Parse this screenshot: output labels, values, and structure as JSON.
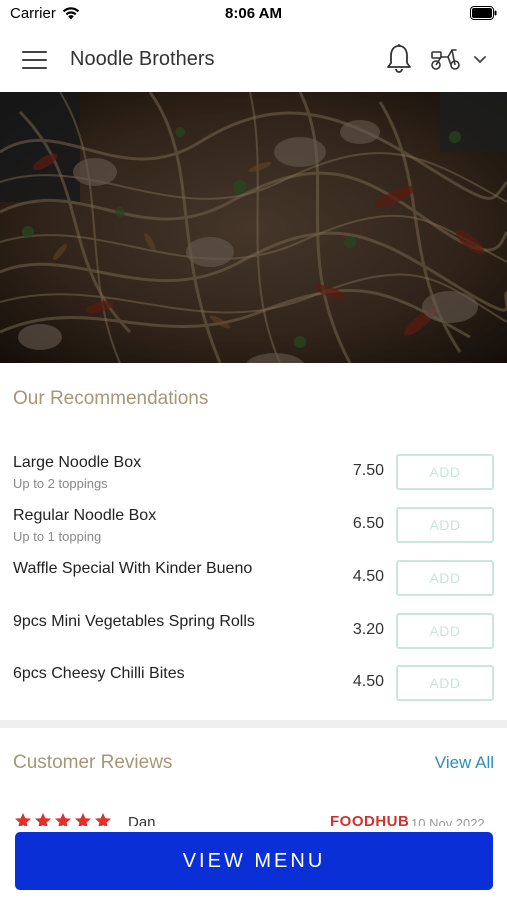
{
  "status_bar": {
    "carrier": "Carrier",
    "time": "8:06 AM"
  },
  "header": {
    "title": "Noodle Brothers",
    "icons": [
      "menu-icon",
      "bell-icon",
      "scooter-icon",
      "chevron-down-icon"
    ]
  },
  "hero": {
    "image": "noodle-dish-photo"
  },
  "recommendations": {
    "title": "Our Recommendations",
    "items": [
      {
        "name": "Large Noodle Box",
        "subtitle": "Up to 2 toppings",
        "price": "7.50",
        "add_label": "ADD"
      },
      {
        "name": "Regular Noodle Box",
        "subtitle": "Up to 1 topping",
        "price": "6.50",
        "add_label": "ADD"
      },
      {
        "name": "Waffle Special With Kinder Bueno",
        "subtitle": "",
        "price": "4.50",
        "add_label": "ADD"
      },
      {
        "name": "9pcs Mini Vegetables Spring Rolls",
        "subtitle": "",
        "price": "3.20",
        "add_label": "ADD"
      },
      {
        "name": "6pcs Cheesy Chilli Bites",
        "subtitle": "",
        "price": "4.50",
        "add_label": "ADD"
      }
    ]
  },
  "reviews": {
    "title": "Customer Reviews",
    "view_all_label": "View All",
    "first_review": {
      "rating": 5,
      "reviewer": "Dan",
      "source": "FOODHUB",
      "date": "10 Nov 2022"
    }
  },
  "cta": {
    "label": "VIEW MENU"
  },
  "colors": {
    "accent_blue": "#0a2fd6",
    "section_title": "#a89677",
    "link": "#2a8fc0",
    "add_border": "#c9e8dd",
    "star": "#e0302b"
  }
}
